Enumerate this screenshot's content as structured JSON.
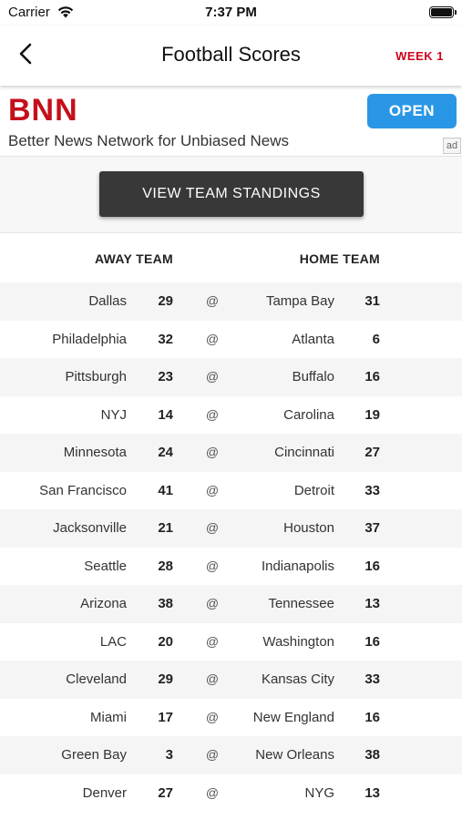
{
  "status_bar": {
    "carrier": "Carrier",
    "time": "7:37 PM"
  },
  "nav": {
    "title": "Football Scores",
    "week": "WEEK 1"
  },
  "ad": {
    "logo": "BNN",
    "tagline": "Better News Network for Unbiased News",
    "open": "OPEN",
    "badge": "ad"
  },
  "standings_button": "VIEW TEAM STANDINGS",
  "table": {
    "away_header": "AWAY TEAM",
    "home_header": "HOME TEAM",
    "separator": "@",
    "games": [
      {
        "away": "Dallas",
        "away_score": "29",
        "home": "Tampa Bay",
        "home_score": "31"
      },
      {
        "away": "Philadelphia",
        "away_score": "32",
        "home": "Atlanta",
        "home_score": "6"
      },
      {
        "away": "Pittsburgh",
        "away_score": "23",
        "home": "Buffalo",
        "home_score": "16"
      },
      {
        "away": "NYJ",
        "away_score": "14",
        "home": "Carolina",
        "home_score": "19"
      },
      {
        "away": "Minnesota",
        "away_score": "24",
        "home": "Cincinnati",
        "home_score": "27"
      },
      {
        "away": "San Francisco",
        "away_score": "41",
        "home": "Detroit",
        "home_score": "33"
      },
      {
        "away": "Jacksonville",
        "away_score": "21",
        "home": "Houston",
        "home_score": "37"
      },
      {
        "away": "Seattle",
        "away_score": "28",
        "home": "Indianapolis",
        "home_score": "16"
      },
      {
        "away": "Arizona",
        "away_score": "38",
        "home": "Tennessee",
        "home_score": "13"
      },
      {
        "away": "LAC",
        "away_score": "20",
        "home": "Washington",
        "home_score": "16"
      },
      {
        "away": "Cleveland",
        "away_score": "29",
        "home": "Kansas City",
        "home_score": "33"
      },
      {
        "away": "Miami",
        "away_score": "17",
        "home": "New England",
        "home_score": "16"
      },
      {
        "away": "Green Bay",
        "away_score": "3",
        "home": "New Orleans",
        "home_score": "38"
      },
      {
        "away": "Denver",
        "away_score": "27",
        "home": "NYG",
        "home_score": "13"
      }
    ]
  },
  "icons": {
    "wifi": "wifi-icon",
    "battery": "battery-icon",
    "back": "chevron-left-icon"
  },
  "colors": {
    "accent_red": "#d0021b",
    "ad_logo_red": "#c4101a",
    "open_blue": "#2a97e6",
    "button_dark": "#383838"
  }
}
